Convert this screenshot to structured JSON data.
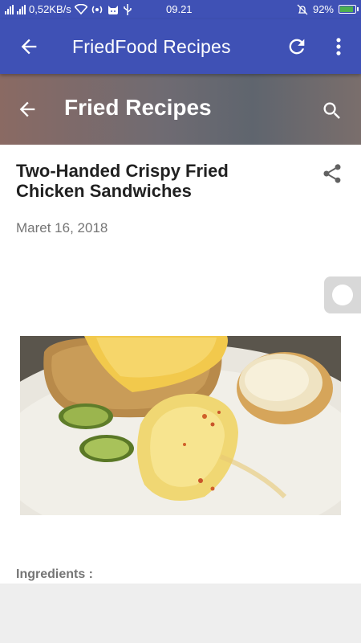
{
  "status_bar": {
    "network_speed": "0,52KB/s",
    "time": "09.21",
    "battery_percent": "92%",
    "battery_level": 0.92
  },
  "app_bar": {
    "title": "FriedFood Recipes",
    "back_icon": "arrow-left-icon",
    "refresh_icon": "refresh-icon",
    "more_icon": "more-vert-icon",
    "color": "#3f51b5"
  },
  "section_header": {
    "title": "Fried Recipes",
    "back_icon": "arrow-left-icon",
    "search_icon": "search-icon"
  },
  "post": {
    "title": "Two-Handed Crispy Fried Chicken Sandwiches",
    "date": "Maret 16, 2018",
    "share_icon": "share-icon",
    "ingredients_label": "Ingredients :"
  }
}
